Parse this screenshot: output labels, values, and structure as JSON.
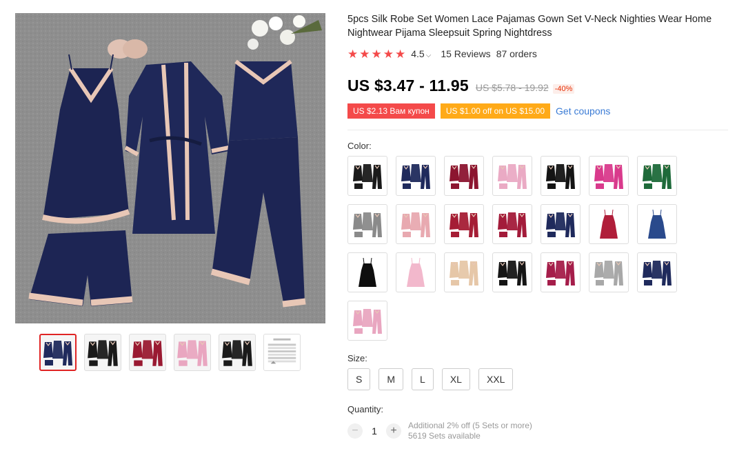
{
  "product": {
    "title": "5pcs Silk Robe Set Women Lace Pajamas Gown Set V-Neck Nighties Wear Home Nightwear Pijama Sleepsuit Spring Nightdress",
    "rating": {
      "stars": 5,
      "value": "4.5",
      "reviews": "15 Reviews",
      "orders": "87 orders"
    },
    "price": {
      "current": "US $3.47 - 11.95",
      "original": "US $5.78 - 19.92",
      "discount": "-40%"
    },
    "coupons": {
      "store_coupon": "US $2.13 Вам купон",
      "offer": "US $1.00 off on US $15.00",
      "get_coupons": "Get coupons"
    },
    "color": {
      "label": "Color:",
      "options": [
        {
          "color": "#1a1a1a",
          "style": "set"
        },
        {
          "color": "#1f2a5c",
          "style": "set"
        },
        {
          "color": "#8c1530",
          "style": "set"
        },
        {
          "color": "#eaaac4",
          "style": "set"
        },
        {
          "color": "#141414",
          "style": "set"
        },
        {
          "color": "#d93a8c",
          "style": "set"
        },
        {
          "color": "#1e6a3a",
          "style": "set"
        },
        {
          "color": "#8a8a8a",
          "style": "set"
        },
        {
          "color": "#e8a9b0",
          "style": "set"
        },
        {
          "color": "#a51d35",
          "style": "set"
        },
        {
          "color": "#a31b3a",
          "style": "set"
        },
        {
          "color": "#1f2a5c",
          "style": "set"
        },
        {
          "color": "#b01e3a",
          "style": "dress"
        },
        {
          "color": "#2a4a8c",
          "style": "dress"
        },
        {
          "color": "#0e0e0e",
          "style": "dress"
        },
        {
          "color": "#f2b8cc",
          "style": "dress"
        },
        {
          "color": "#e6c7a8",
          "style": "set"
        },
        {
          "color": "#151515",
          "style": "set"
        },
        {
          "color": "#a51d4a",
          "style": "set"
        },
        {
          "color": "#a8a8a8",
          "style": "set"
        },
        {
          "color": "#1f2a5c",
          "style": "set"
        },
        {
          "color": "#e9a6c0",
          "style": "set"
        }
      ]
    },
    "size": {
      "label": "Size:",
      "options": [
        "S",
        "M",
        "L",
        "XL",
        "XXL"
      ]
    },
    "quantity": {
      "label": "Quantity:",
      "value": "1",
      "minus": "−",
      "plus": "+",
      "bulk_offer": "Additional 2% off (5 Sets or more)",
      "available": "5619 Sets available"
    },
    "gallery": {
      "thumbnails": [
        {
          "color": "#1f2a5c",
          "kind": "photo"
        },
        {
          "color": "#1a1a1a",
          "kind": "photo"
        },
        {
          "color": "#9a1a32",
          "kind": "photo"
        },
        {
          "color": "#e9a6c0",
          "kind": "photo"
        },
        {
          "color": "#1a1a1a",
          "kind": "photo"
        },
        {
          "color": "#ffffff",
          "kind": "size-chart",
          "caption": "SIZE CHART"
        }
      ]
    }
  }
}
